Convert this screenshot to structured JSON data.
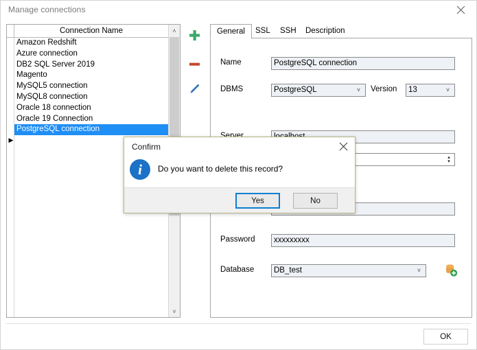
{
  "window": {
    "title": "Manage connections",
    "close_icon": "close-icon"
  },
  "connection_list": {
    "header": "Connection Name",
    "selected_index": 8,
    "marker_glyph": "▶",
    "items": [
      "Amazon Redshift",
      "Azure connection",
      "DB2 SQL Server 2019",
      "Magento",
      "MySQL5 connection",
      "MySQL8 connection",
      "Oracle 18 connection",
      "Oracle 19 Connection",
      "PostgreSQL connection"
    ],
    "scrollbar": {
      "up_glyph": "˄",
      "down_glyph": "˅"
    }
  },
  "toolbar": {
    "add_label": "add-connection",
    "remove_label": "remove-connection",
    "edit_label": "edit-connection",
    "add_color": "#3aa86a",
    "remove_color": "#c6462c",
    "edit_color": "#2f6fb5"
  },
  "tabs": [
    {
      "label": "General",
      "active": true
    },
    {
      "label": "SSL",
      "active": false
    },
    {
      "label": "SSH",
      "active": false
    },
    {
      "label": "Description",
      "active": false
    }
  ],
  "form": {
    "name_label": "Name",
    "name_value": "PostgreSQL connection",
    "dbms_label": "DBMS",
    "dbms_value": "PostgreSQL",
    "version_label": "Version",
    "version_value": "13",
    "server_label": "Server",
    "server_value": "localhost",
    "port_value": "",
    "user_value": "",
    "password_label": "Password",
    "password_value": "xxxxxxxxx",
    "database_label": "Database",
    "database_value": "DB_test",
    "caret_glyph": "˅",
    "spin_up_glyph": "▴",
    "spin_down_glyph": "▾",
    "create_db_icon": "database-add-icon"
  },
  "footer": {
    "ok_label": "OK"
  },
  "confirm_dialog": {
    "title": "Confirm",
    "message": "Do you want to delete this record?",
    "icon_glyph": "i",
    "icon_color": "#1b72c6",
    "yes_label": "Yes",
    "no_label": "No",
    "close_icon": "close-icon",
    "border_color": "#b4b486"
  }
}
